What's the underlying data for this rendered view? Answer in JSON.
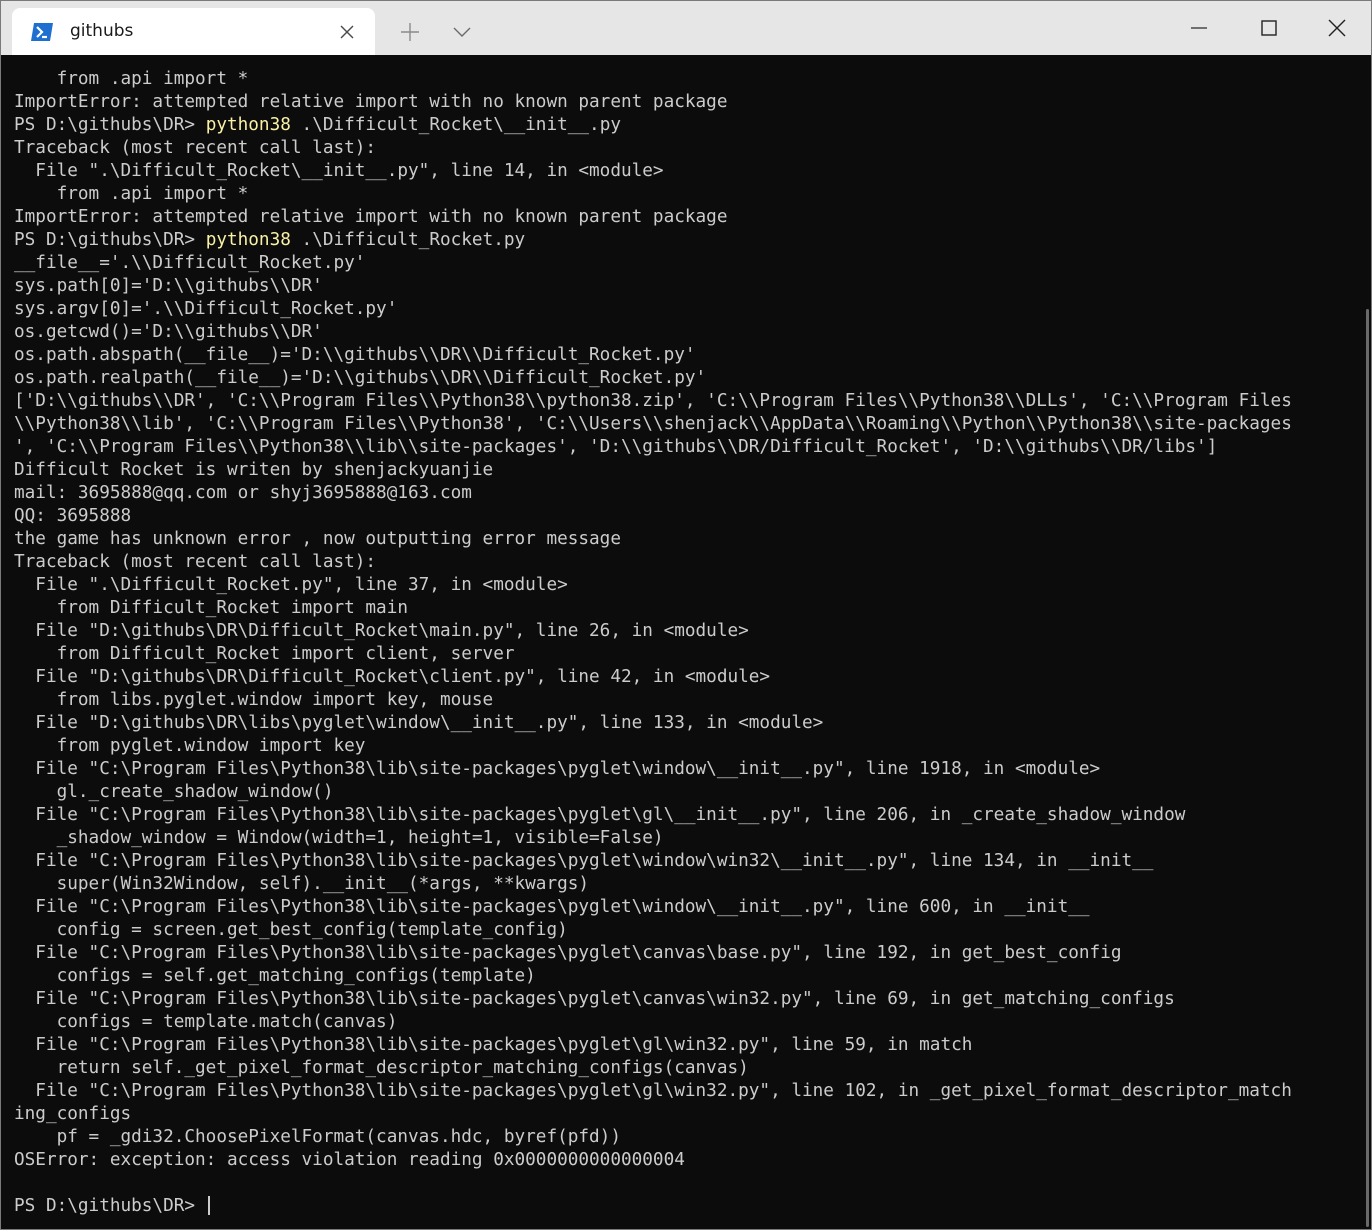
{
  "window": {
    "tab_title": "githubs",
    "tab_icon": "powershell-icon"
  },
  "titlebar": {
    "new_tab_icon": "plus-icon",
    "dropdown_icon": "chevron-down-icon",
    "controls": [
      "minimize-icon",
      "maximize-icon",
      "close-icon"
    ]
  },
  "colors": {
    "background": "#0c0c0c",
    "text": "#cccccc",
    "command_highlight": "#f9f1a5",
    "titlebar": "#e6e6e6",
    "tab_active": "#ffffff"
  },
  "terminal": {
    "lines": [
      {
        "text": "    from .api import *"
      },
      {
        "text": "ImportError: attempted relative import with no known parent package"
      },
      {
        "prompt": "PS D:\\githubs\\DR> ",
        "command": "python38",
        "args": " .\\Difficult_Rocket\\__init__.py"
      },
      {
        "text": "Traceback (most recent call last):"
      },
      {
        "text": "  File \".\\Difficult_Rocket\\__init__.py\", line 14, in <module>"
      },
      {
        "text": "    from .api import *"
      },
      {
        "text": "ImportError: attempted relative import with no known parent package"
      },
      {
        "prompt": "PS D:\\githubs\\DR> ",
        "command": "python38",
        "args": " .\\Difficult_Rocket.py"
      },
      {
        "text": "__file__='.\\\\Difficult_Rocket.py'"
      },
      {
        "text": "sys.path[0]='D:\\\\githubs\\\\DR'"
      },
      {
        "text": "sys.argv[0]='.\\\\Difficult_Rocket.py'"
      },
      {
        "text": "os.getcwd()='D:\\\\githubs\\\\DR'"
      },
      {
        "text": "os.path.abspath(__file__)='D:\\\\githubs\\\\DR\\\\Difficult_Rocket.py'"
      },
      {
        "text": "os.path.realpath(__file__)='D:\\\\githubs\\\\DR\\\\Difficult_Rocket.py'"
      },
      {
        "text": "['D:\\\\githubs\\\\DR', 'C:\\\\Program Files\\\\Python38\\\\python38.zip', 'C:\\\\Program Files\\\\Python38\\\\DLLs', 'C:\\\\Program Files"
      },
      {
        "text": "\\\\Python38\\\\lib', 'C:\\\\Program Files\\\\Python38', 'C:\\\\Users\\\\shenjack\\\\AppData\\\\Roaming\\\\Python\\\\Python38\\\\site-packages"
      },
      {
        "text": "', 'C:\\\\Program Files\\\\Python38\\\\lib\\\\site-packages', 'D:\\\\githubs\\\\DR/Difficult_Rocket', 'D:\\\\githubs\\\\DR/libs']"
      },
      {
        "text": "Difficult Rocket is writen by shenjackyuanjie"
      },
      {
        "text": "mail: 3695888@qq.com or shyj3695888@163.com"
      },
      {
        "text": "QQ: 3695888"
      },
      {
        "text": "the game has unknown error , now outputting error message"
      },
      {
        "text": "Traceback (most recent call last):"
      },
      {
        "text": "  File \".\\Difficult_Rocket.py\", line 37, in <module>"
      },
      {
        "text": "    from Difficult_Rocket import main"
      },
      {
        "text": "  File \"D:\\githubs\\DR\\Difficult_Rocket\\main.py\", line 26, in <module>"
      },
      {
        "text": "    from Difficult_Rocket import client, server"
      },
      {
        "text": "  File \"D:\\githubs\\DR\\Difficult_Rocket\\client.py\", line 42, in <module>"
      },
      {
        "text": "    from libs.pyglet.window import key, mouse"
      },
      {
        "text": "  File \"D:\\githubs\\DR\\libs\\pyglet\\window\\__init__.py\", line 133, in <module>"
      },
      {
        "text": "    from pyglet.window import key"
      },
      {
        "text": "  File \"C:\\Program Files\\Python38\\lib\\site-packages\\pyglet\\window\\__init__.py\", line 1918, in <module>"
      },
      {
        "text": "    gl._create_shadow_window()"
      },
      {
        "text": "  File \"C:\\Program Files\\Python38\\lib\\site-packages\\pyglet\\gl\\__init__.py\", line 206, in _create_shadow_window"
      },
      {
        "text": "    _shadow_window = Window(width=1, height=1, visible=False)"
      },
      {
        "text": "  File \"C:\\Program Files\\Python38\\lib\\site-packages\\pyglet\\window\\win32\\__init__.py\", line 134, in __init__"
      },
      {
        "text": "    super(Win32Window, self).__init__(*args, **kwargs)"
      },
      {
        "text": "  File \"C:\\Program Files\\Python38\\lib\\site-packages\\pyglet\\window\\__init__.py\", line 600, in __init__"
      },
      {
        "text": "    config = screen.get_best_config(template_config)"
      },
      {
        "text": "  File \"C:\\Program Files\\Python38\\lib\\site-packages\\pyglet\\canvas\\base.py\", line 192, in get_best_config"
      },
      {
        "text": "    configs = self.get_matching_configs(template)"
      },
      {
        "text": "  File \"C:\\Program Files\\Python38\\lib\\site-packages\\pyglet\\canvas\\win32.py\", line 69, in get_matching_configs"
      },
      {
        "text": "    configs = template.match(canvas)"
      },
      {
        "text": "  File \"C:\\Program Files\\Python38\\lib\\site-packages\\pyglet\\gl\\win32.py\", line 59, in match"
      },
      {
        "text": "    return self._get_pixel_format_descriptor_matching_configs(canvas)"
      },
      {
        "text": "  File \"C:\\Program Files\\Python38\\lib\\site-packages\\pyglet\\gl\\win32.py\", line 102, in _get_pixel_format_descriptor_match"
      },
      {
        "text": "ing_configs"
      },
      {
        "text": "    pf = _gdi32.ChoosePixelFormat(canvas.hdc, byref(pfd))"
      },
      {
        "text": "OSError: exception: access violation reading 0x0000000000000004"
      },
      {
        "text": ""
      },
      {
        "prompt": "PS D:\\githubs\\DR> ",
        "cursor": true
      }
    ]
  }
}
